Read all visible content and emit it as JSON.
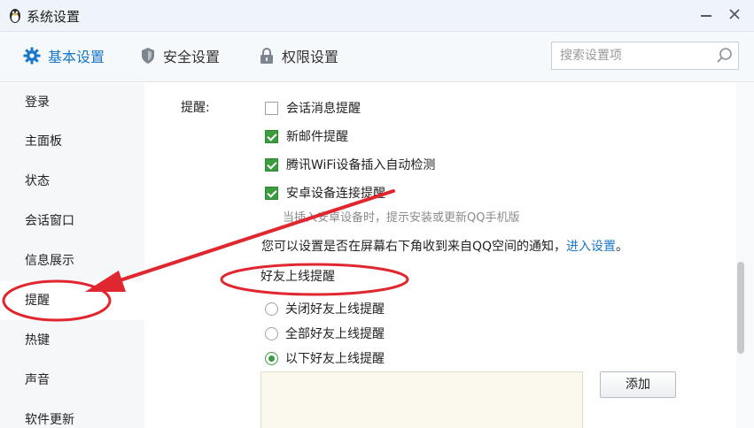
{
  "window": {
    "title": "系统设置"
  },
  "tabs": [
    {
      "label": "基本设置",
      "active": true
    },
    {
      "label": "安全设置",
      "active": false
    },
    {
      "label": "权限设置",
      "active": false
    }
  ],
  "search": {
    "placeholder": "搜索设置项"
  },
  "sidebar": {
    "items": [
      {
        "label": "登录"
      },
      {
        "label": "主面板"
      },
      {
        "label": "状态"
      },
      {
        "label": "会话窗口"
      },
      {
        "label": "信息展示"
      },
      {
        "label": "提醒",
        "active": true
      },
      {
        "label": "热键"
      },
      {
        "label": "声音"
      },
      {
        "label": "软件更新"
      }
    ]
  },
  "remind": {
    "label": "提醒:",
    "options": [
      {
        "label": "会话消息提醒",
        "checked": false
      },
      {
        "label": "新邮件提醒",
        "checked": true
      },
      {
        "label": "腾讯WiFi设备插入自动检测",
        "checked": true
      },
      {
        "label": "安卓设备连接提醒",
        "checked": true
      }
    ],
    "hint": "当插入安卓设备时，提示安装或更新QQ手机版",
    "qzone_text": "您可以设置是否在屏幕右下角收到来自QQ空间的通知，",
    "qzone_link": "进入设置",
    "qzone_tail": "。"
  },
  "friend_online": {
    "title": "好友上线提醒",
    "options": [
      {
        "label": "关闭好友上线提醒",
        "checked": false
      },
      {
        "label": "全部好友上线提醒",
        "checked": false
      },
      {
        "label": "以下好友上线提醒",
        "checked": true
      }
    ],
    "add_label": "添加"
  },
  "colors": {
    "accent": "#1a77c9",
    "annotation": "#e0262e",
    "check": "#3a9c3f"
  }
}
